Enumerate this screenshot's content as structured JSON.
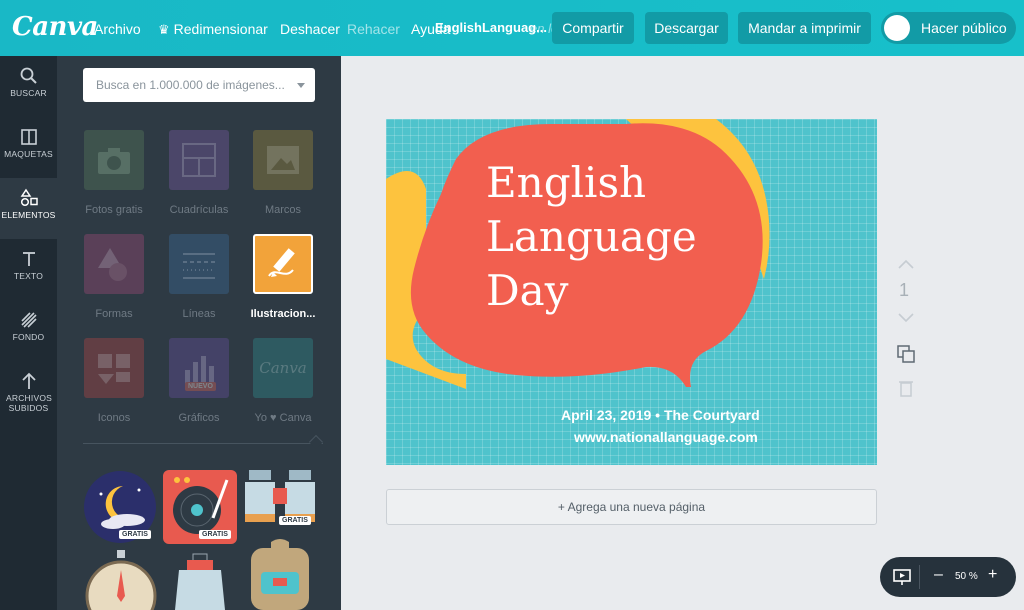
{
  "topbar": {
    "logo": "Canva",
    "menu": [
      "Archivo",
      "Redimensionar",
      "Deshacer",
      "Rehacer",
      "Ayuda"
    ],
    "doc_title": "EnglishLanguag...",
    "saved_hint": "en lo ...",
    "buttons": [
      "Compartir",
      "Descargar",
      "Mandar a imprimir"
    ],
    "public_toggle": "Hacer público"
  },
  "leftnav": {
    "items": [
      {
        "label": "BUSCAR",
        "icon": "search-icon"
      },
      {
        "label": "MAQUETAS",
        "icon": "layout-icon"
      },
      {
        "label": "ELEMENTOS",
        "icon": "shapes-icon"
      },
      {
        "label": "TEXTO",
        "icon": "text-icon"
      },
      {
        "label": "FONDO",
        "icon": "background-icon"
      },
      {
        "label": "ARCHIVOS SUBIDOS",
        "icon": "upload-icon"
      }
    ],
    "active": "ELEMENTOS"
  },
  "panel": {
    "search_placeholder": "Busca en 1.000.000 de imágenes...",
    "categories": [
      {
        "label": "Fotos gratis",
        "color": "#5a7d5c",
        "icon": "camera-icon"
      },
      {
        "label": "Cuadrículas",
        "color": "#7b5aa6",
        "icon": "grid-icon"
      },
      {
        "label": "Marcos",
        "color": "#a38b3c",
        "icon": "frame-icon"
      },
      {
        "label": "Formas",
        "color": "#a14a7a",
        "icon": "shapes-icon"
      },
      {
        "label": "Líneas",
        "color": "#3d6e9c",
        "icon": "lines-icon"
      },
      {
        "label": "Ilustracion...",
        "color": "#f2a33a",
        "icon": "pencil-icon"
      },
      {
        "label": "Iconos",
        "color": "#b54646",
        "icon": "icons-icon"
      },
      {
        "label": "Gráficos",
        "color": "#6a4fa0",
        "icon": "chart-icon",
        "badge": "NUEVO"
      },
      {
        "label": "Yo ♥ Canva",
        "color": "#2f8f90",
        "icon": "canva-icon"
      }
    ],
    "selected_category": "Ilustracion...",
    "illustrations": [
      {
        "name": "night-moon-illustration",
        "badge": "GRATIS"
      },
      {
        "name": "turntable-illustration",
        "badge": "GRATIS"
      },
      {
        "name": "binoculars-illustration",
        "badge": "GRATIS"
      }
    ]
  },
  "design": {
    "headline_lines": [
      "English",
      "Language",
      "Day"
    ],
    "event_line": "April 23, 2019  •  The Courtyard",
    "url_line": "www.nationallanguage.com",
    "colors": {
      "background": "#4fc3cc",
      "bubble": "#f25f4f",
      "accent": "#fdc33e"
    }
  },
  "workspace": {
    "add_page": "+ Agrega una nueva página",
    "page_number": "1",
    "zoom": "50 %"
  }
}
